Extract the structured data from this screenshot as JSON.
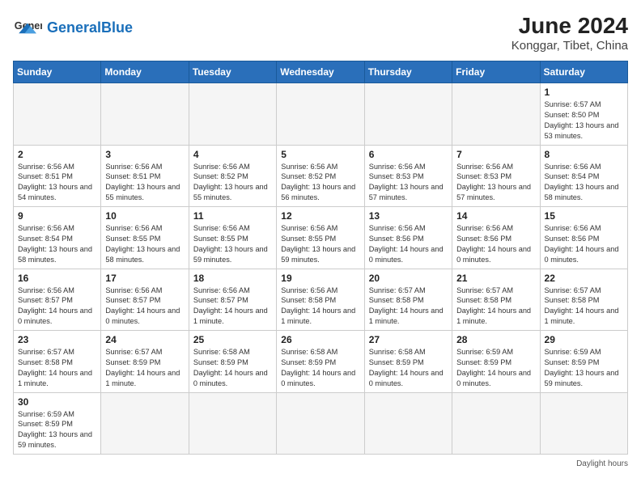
{
  "header": {
    "logo_text_general": "General",
    "logo_text_blue": "Blue",
    "month_year": "June 2024",
    "location": "Konggar, Tibet, China"
  },
  "weekdays": [
    "Sunday",
    "Monday",
    "Tuesday",
    "Wednesday",
    "Thursday",
    "Friday",
    "Saturday"
  ],
  "days": [
    {
      "date": "",
      "info": ""
    },
    {
      "date": "",
      "info": ""
    },
    {
      "date": "",
      "info": ""
    },
    {
      "date": "",
      "info": ""
    },
    {
      "date": "",
      "info": ""
    },
    {
      "date": "",
      "info": ""
    },
    {
      "date": "1",
      "sunrise": "6:57 AM",
      "sunset": "8:50 PM",
      "daylight": "13 hours and 53 minutes."
    },
    {
      "date": "2",
      "sunrise": "6:56 AM",
      "sunset": "8:51 PM",
      "daylight": "13 hours and 54 minutes."
    },
    {
      "date": "3",
      "sunrise": "6:56 AM",
      "sunset": "8:51 PM",
      "daylight": "13 hours and 55 minutes."
    },
    {
      "date": "4",
      "sunrise": "6:56 AM",
      "sunset": "8:52 PM",
      "daylight": "13 hours and 55 minutes."
    },
    {
      "date": "5",
      "sunrise": "6:56 AM",
      "sunset": "8:52 PM",
      "daylight": "13 hours and 56 minutes."
    },
    {
      "date": "6",
      "sunrise": "6:56 AM",
      "sunset": "8:53 PM",
      "daylight": "13 hours and 57 minutes."
    },
    {
      "date": "7",
      "sunrise": "6:56 AM",
      "sunset": "8:53 PM",
      "daylight": "13 hours and 57 minutes."
    },
    {
      "date": "8",
      "sunrise": "6:56 AM",
      "sunset": "8:54 PM",
      "daylight": "13 hours and 58 minutes."
    },
    {
      "date": "9",
      "sunrise": "6:56 AM",
      "sunset": "8:54 PM",
      "daylight": "13 hours and 58 minutes."
    },
    {
      "date": "10",
      "sunrise": "6:56 AM",
      "sunset": "8:55 PM",
      "daylight": "13 hours and 58 minutes."
    },
    {
      "date": "11",
      "sunrise": "6:56 AM",
      "sunset": "8:55 PM",
      "daylight": "13 hours and 59 minutes."
    },
    {
      "date": "12",
      "sunrise": "6:56 AM",
      "sunset": "8:55 PM",
      "daylight": "13 hours and 59 minutes."
    },
    {
      "date": "13",
      "sunrise": "6:56 AM",
      "sunset": "8:56 PM",
      "daylight": "14 hours and 0 minutes."
    },
    {
      "date": "14",
      "sunrise": "6:56 AM",
      "sunset": "8:56 PM",
      "daylight": "14 hours and 0 minutes."
    },
    {
      "date": "15",
      "sunrise": "6:56 AM",
      "sunset": "8:56 PM",
      "daylight": "14 hours and 0 minutes."
    },
    {
      "date": "16",
      "sunrise": "6:56 AM",
      "sunset": "8:57 PM",
      "daylight": "14 hours and 0 minutes."
    },
    {
      "date": "17",
      "sunrise": "6:56 AM",
      "sunset": "8:57 PM",
      "daylight": "14 hours and 0 minutes."
    },
    {
      "date": "18",
      "sunrise": "6:56 AM",
      "sunset": "8:57 PM",
      "daylight": "14 hours and 1 minute."
    },
    {
      "date": "19",
      "sunrise": "6:56 AM",
      "sunset": "8:58 PM",
      "daylight": "14 hours and 1 minute."
    },
    {
      "date": "20",
      "sunrise": "6:57 AM",
      "sunset": "8:58 PM",
      "daylight": "14 hours and 1 minute."
    },
    {
      "date": "21",
      "sunrise": "6:57 AM",
      "sunset": "8:58 PM",
      "daylight": "14 hours and 1 minute."
    },
    {
      "date": "22",
      "sunrise": "6:57 AM",
      "sunset": "8:58 PM",
      "daylight": "14 hours and 1 minute."
    },
    {
      "date": "23",
      "sunrise": "6:57 AM",
      "sunset": "8:58 PM",
      "daylight": "14 hours and 1 minute."
    },
    {
      "date": "24",
      "sunrise": "6:57 AM",
      "sunset": "8:59 PM",
      "daylight": "14 hours and 1 minute."
    },
    {
      "date": "25",
      "sunrise": "6:58 AM",
      "sunset": "8:59 PM",
      "daylight": "14 hours and 0 minutes."
    },
    {
      "date": "26",
      "sunrise": "6:58 AM",
      "sunset": "8:59 PM",
      "daylight": "14 hours and 0 minutes."
    },
    {
      "date": "27",
      "sunrise": "6:58 AM",
      "sunset": "8:59 PM",
      "daylight": "14 hours and 0 minutes."
    },
    {
      "date": "28",
      "sunrise": "6:59 AM",
      "sunset": "8:59 PM",
      "daylight": "14 hours and 0 minutes."
    },
    {
      "date": "29",
      "sunrise": "6:59 AM",
      "sunset": "8:59 PM",
      "daylight": "13 hours and 59 minutes."
    },
    {
      "date": "30",
      "sunrise": "6:59 AM",
      "sunset": "8:59 PM",
      "daylight": "13 hours and 59 minutes."
    }
  ],
  "footer": {
    "daylight_label": "Daylight hours"
  },
  "colors": {
    "header_bg": "#2a6fba",
    "header_text": "#ffffff",
    "logo_blue": "#1a6fba"
  }
}
